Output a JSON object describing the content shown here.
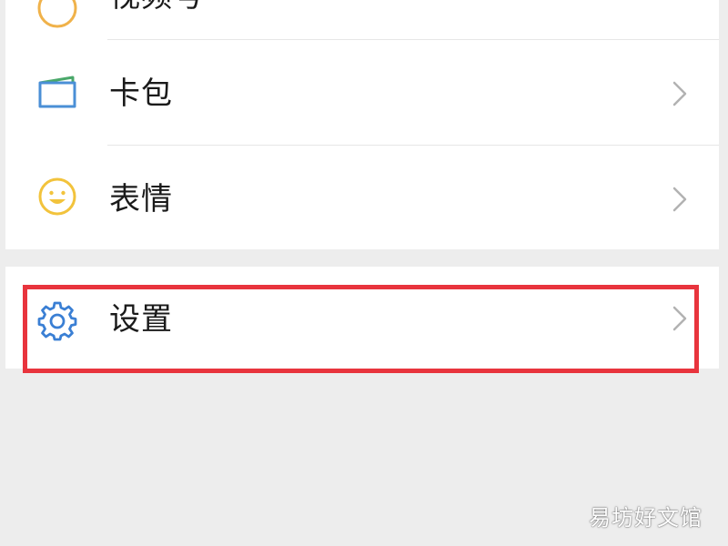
{
  "menu": {
    "top_item": {
      "label": "视频号",
      "icon": "channels-icon"
    },
    "wallet_item": {
      "label": "卡包",
      "icon": "wallet-icon"
    },
    "emoji_item": {
      "label": "表情",
      "icon": "emoji-icon"
    },
    "settings_item": {
      "label": "设置",
      "icon": "gear-icon"
    }
  },
  "highlight": {
    "color": "#e8343d",
    "target": "settings_item"
  },
  "watermark": {
    "text": "易坊好文馆"
  },
  "colors": {
    "background": "#ededed",
    "panel": "#ffffff",
    "wallet_icon": "#4a8fd6",
    "emoji_icon": "#f2c33c",
    "gear_icon": "#3a7fd4",
    "chevron": "#b2b2b2"
  }
}
